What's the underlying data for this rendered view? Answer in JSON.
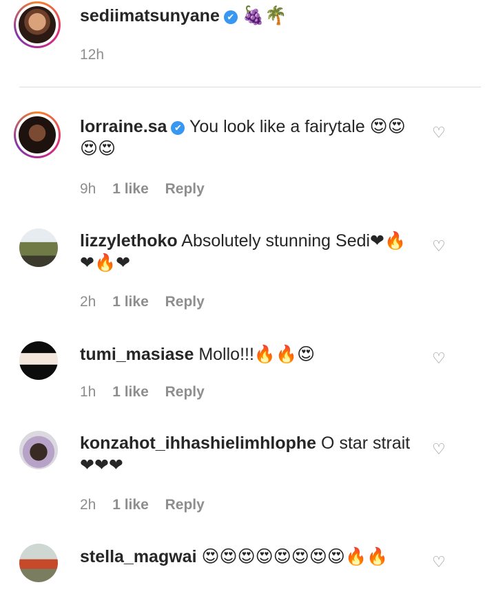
{
  "caption": {
    "username": "sediimatsunyane",
    "verified": "✔",
    "text": "🍇🌴",
    "time": "12h"
  },
  "comments": [
    {
      "username": "lorraine.sa",
      "verified": "✔",
      "text": "You look like a fairytale 😍😍😍😍",
      "time": "9h",
      "likes": "1 like",
      "reply": "Reply"
    },
    {
      "username": "lizzylethoko",
      "text": "Absolutely stunning Sedi❤🔥❤🔥❤",
      "time": "2h",
      "likes": "1 like",
      "reply": "Reply"
    },
    {
      "username": "tumi_masiase",
      "text": "Mollo!!!🔥🔥😍",
      "time": "1h",
      "likes": "1 like",
      "reply": "Reply"
    },
    {
      "username": "konzahot_ihhashielimhlophe",
      "text": "O star strait❤❤❤",
      "time": "2h",
      "likes": "1 like",
      "reply": "Reply"
    },
    {
      "username": "stella_magwai",
      "text": "😍😍😍😍😍😍😍😍🔥🔥",
      "time": "",
      "likes": "",
      "reply": ""
    }
  ],
  "icons": {
    "like": "heart-outline-icon",
    "verified": "verified-badge-icon"
  },
  "colors": {
    "verified": "#3897f0",
    "muted": "#8e8e8e",
    "text": "#262626"
  }
}
